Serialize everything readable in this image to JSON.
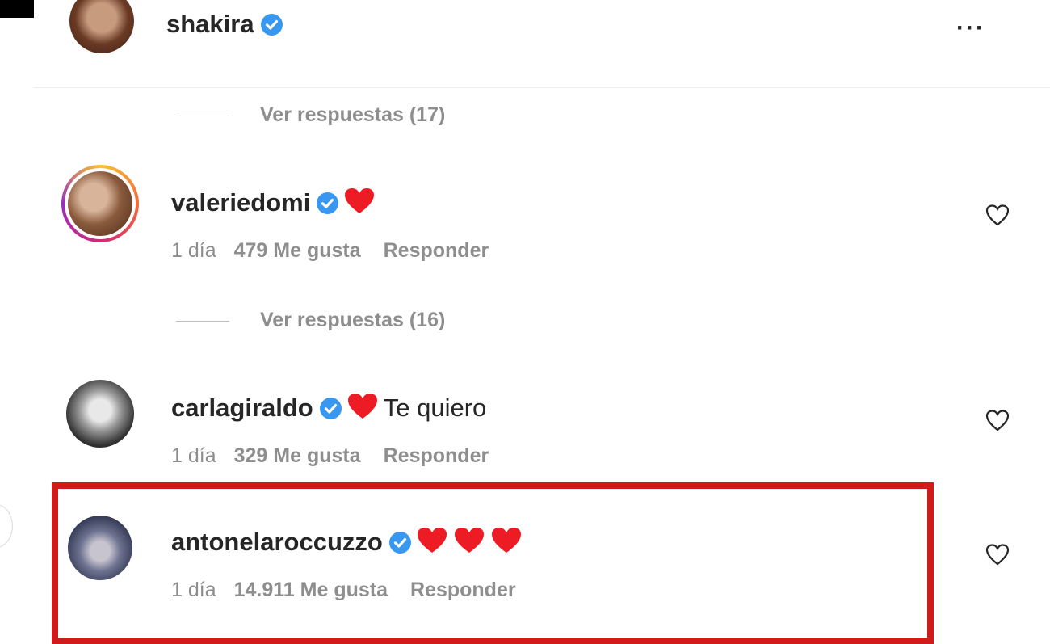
{
  "post": {
    "author": "shakira",
    "more_label": "···"
  },
  "comments": [
    {
      "replies_label": "Ver respuestas (17)"
    },
    {
      "username": "valeriedomi",
      "text": "",
      "hearts": 1,
      "time": "1 día",
      "likes": "479 Me gusta",
      "reply": "Responder",
      "replies_label": "Ver respuestas (16)"
    },
    {
      "username": "carlagiraldo",
      "text": "Te quiero",
      "hearts": 1,
      "time": "1 día",
      "likes": "329 Me gusta",
      "reply": "Responder"
    },
    {
      "username": "antonelaroccuzzo",
      "text": "",
      "hearts": 3,
      "time": "1 día",
      "likes": "14.911 Me gusta",
      "reply": "Responder"
    }
  ],
  "colors": {
    "verified": "#3897f0",
    "heart": "#ed1c24",
    "highlight": "#d11b1b",
    "muted_text": "#8e8e8e"
  }
}
